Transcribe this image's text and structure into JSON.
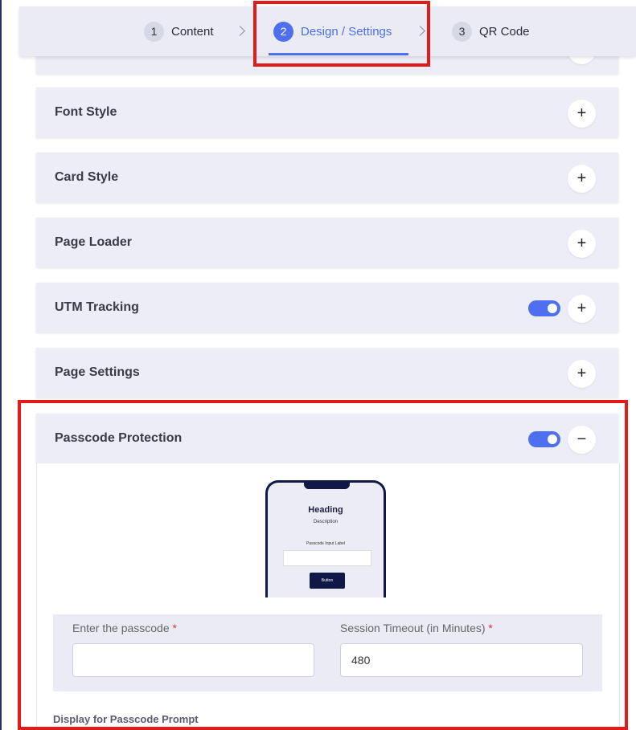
{
  "stepper": {
    "steps": [
      {
        "num": "1",
        "label": "Content"
      },
      {
        "num": "2",
        "label": "Design / Settings"
      },
      {
        "num": "3",
        "label": "QR Code"
      }
    ]
  },
  "panels": [
    {
      "title": "Font Style",
      "action": "+"
    },
    {
      "title": "Card Style",
      "action": "+"
    },
    {
      "title": "Page Loader",
      "action": "+"
    },
    {
      "title": "UTM Tracking",
      "action": "+",
      "toggle_on": true
    },
    {
      "title": "Page Settings",
      "action": "+"
    },
    {
      "title": "Passcode Protection",
      "action": "−",
      "toggle_on": true
    }
  ],
  "preview": {
    "heading": "Heading",
    "description": "Description",
    "input_label": "Passcode Input Label",
    "button": "Button"
  },
  "form": {
    "passcode_label": "Enter the passcode",
    "passcode_value": "",
    "timeout_label": "Session Timeout (in Minutes)",
    "timeout_value": "480",
    "required_mark": "*"
  },
  "display_section_label": "Display for Passcode Prompt",
  "colors": {
    "accent": "#4d6ff0",
    "highlight": "#e31a1a",
    "panel_bg": "#ededf8"
  }
}
